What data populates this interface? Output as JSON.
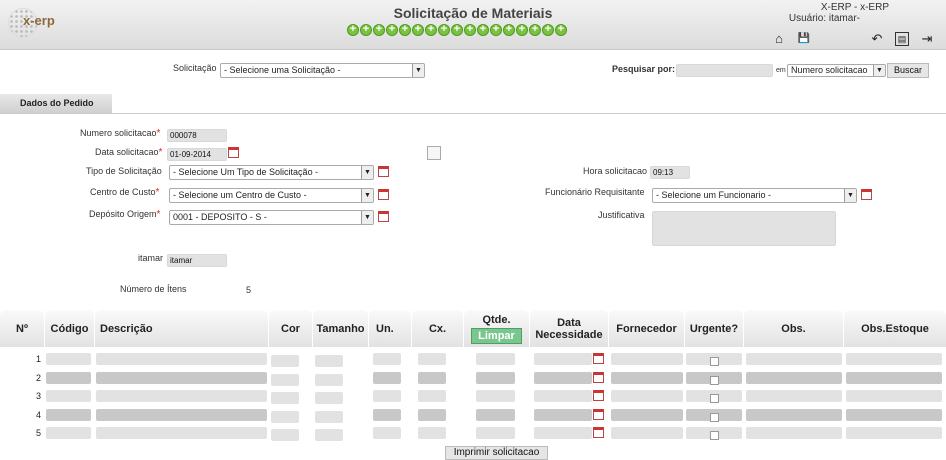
{
  "header": {
    "title": "Solicitação de Materiais",
    "system": "X-ERP - x-ERP",
    "user": "Usuário: itamar-",
    "logo_text": "x-erp",
    "plus_count": 17
  },
  "toolbar": {
    "home_icon": "⌂",
    "save_icon": "💾",
    "back_icon": "↶",
    "report_icon": "▤",
    "exit_icon": "⇥"
  },
  "search": {
    "solicitacao_label": "Solicitação",
    "solicitacao_value": "- Selecione uma Solicitação -",
    "pesquisar_label": "Pesquisar por:",
    "em_label": "em",
    "field_value": "Numero solicitacao",
    "buscar": "Buscar"
  },
  "tab": {
    "label": "Dados do Pedido"
  },
  "form": {
    "numero_label": "Numero solicitacao",
    "numero_value": "000078",
    "data_label": "Data solicitacao",
    "data_value": "01-09-2014",
    "tipo_label": "Tipo de Solicitação",
    "tipo_value": "- Selecione Um Tipo de Solicitação -",
    "centro_label": "Centro de Custo",
    "centro_value": "- Selecione um Centro de Custo -",
    "deposito_label": "Depósito Origem",
    "deposito_value": "0001 - DEPOSITO - S -",
    "hora_label": "Hora solicitacao",
    "hora_value": "09:13",
    "funcionario_label": "Funcionário Requisitante",
    "funcionario_value": "- Selecione um Funcionario -",
    "justificativa_label": "Justificativa",
    "itamar_label": "itamar",
    "itamar_value": "itamar",
    "itens_label": "Número de Ítens",
    "itens_value": "5"
  },
  "table": {
    "headers": {
      "n": "Nº",
      "codigo": "Código",
      "descricao": "Descrição",
      "cor": "Cor",
      "tamanho": "Tamanho",
      "un": "Un.",
      "cx": "Cx.",
      "qtde": "Qtde.",
      "limpar": "Limpar",
      "data": "Data Necessidade",
      "fornecedor": "Fornecedor",
      "urgente": "Urgente?",
      "obs": "Obs.",
      "obsestoque": "Obs.Estoque"
    },
    "rows": [
      "1",
      "2",
      "3",
      "4",
      "5"
    ]
  },
  "footer": {
    "print": "Imprimir solicitacao"
  }
}
